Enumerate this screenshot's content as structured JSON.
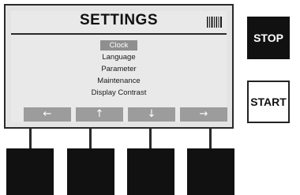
{
  "screen": {
    "title": "SETTINGS",
    "header_icon": "barcode-icon",
    "menu": [
      {
        "label": "Clock",
        "selected": true
      },
      {
        "label": "Language",
        "selected": false
      },
      {
        "label": "Parameter",
        "selected": false
      },
      {
        "label": "Maintenance",
        "selected": false
      },
      {
        "label": "Display Contrast",
        "selected": false
      }
    ],
    "softkeys": [
      {
        "glyph": "←",
        "icon": "arrow-left-icon"
      },
      {
        "glyph": "↑",
        "icon": "arrow-up-icon"
      },
      {
        "glyph": "↓",
        "icon": "arrow-down-icon"
      },
      {
        "glyph": "→",
        "icon": "arrow-right-icon"
      }
    ]
  },
  "buttons": {
    "stop_label": "STOP",
    "start_label": "START"
  },
  "colors": {
    "screen_background": "#e9e9e9",
    "selected_highlight": "#8f8f8f",
    "softkey_background": "#9c9c9c",
    "panel_dark": "#111111"
  }
}
